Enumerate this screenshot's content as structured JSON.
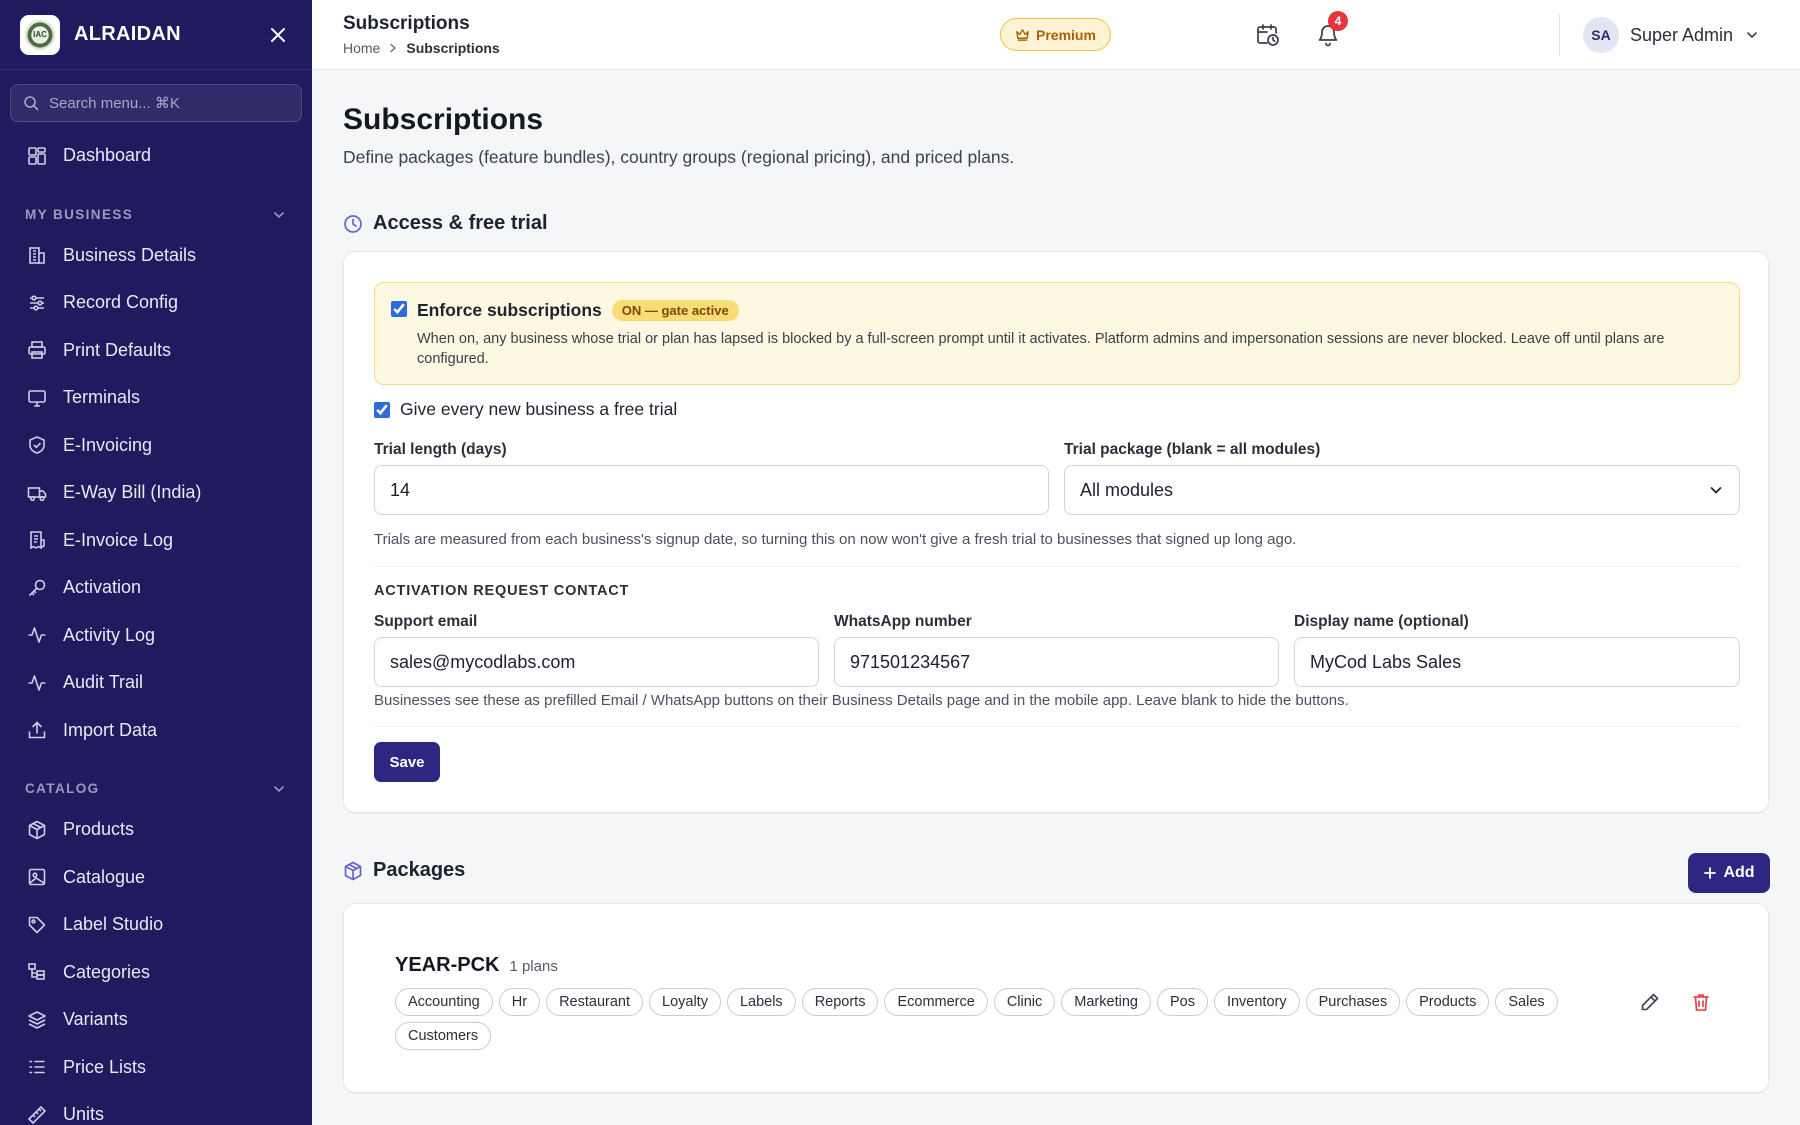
{
  "app": {
    "name": "ALRAIDAN",
    "logo_text": "IAC"
  },
  "sidebar": {
    "search_placeholder": "Search menu... ⌘K",
    "items_top": [
      {
        "label": "Dashboard",
        "icon": "dashboard-icon"
      }
    ],
    "sections": [
      {
        "label": "MY BUSINESS",
        "items": [
          {
            "label": "Business Details",
            "icon": "building-icon"
          },
          {
            "label": "Record Config",
            "icon": "sliders-icon"
          },
          {
            "label": "Print Defaults",
            "icon": "printer-icon"
          },
          {
            "label": "Terminals",
            "icon": "monitor-icon"
          },
          {
            "label": "E-Invoicing",
            "icon": "shield-check-icon"
          },
          {
            "label": "E-Way Bill (India)",
            "icon": "truck-icon"
          },
          {
            "label": "E-Invoice Log",
            "icon": "receipt-icon"
          },
          {
            "label": "Activation",
            "icon": "key-icon"
          },
          {
            "label": "Activity Log",
            "icon": "activity-icon"
          },
          {
            "label": "Audit Trail",
            "icon": "activity-icon"
          },
          {
            "label": "Import Data",
            "icon": "upload-icon"
          }
        ]
      },
      {
        "label": "CATALOG",
        "items": [
          {
            "label": "Products",
            "icon": "package-icon"
          },
          {
            "label": "Catalogue",
            "icon": "image-icon"
          },
          {
            "label": "Label Studio",
            "icon": "tag-icon"
          },
          {
            "label": "Categories",
            "icon": "categories-icon"
          },
          {
            "label": "Variants",
            "icon": "layers-icon"
          },
          {
            "label": "Price Lists",
            "icon": "list-icon"
          },
          {
            "label": "Units",
            "icon": "ruler-icon"
          }
        ]
      }
    ]
  },
  "header": {
    "title": "Subscriptions",
    "breadcrumb": [
      "Home",
      "Subscriptions"
    ],
    "premium_label": "Premium",
    "notification_count": "4",
    "user": {
      "initials": "SA",
      "name": "Super Admin"
    }
  },
  "page": {
    "title": "Subscriptions",
    "description": "Define packages (feature bundles), country groups (regional pricing), and priced plans."
  },
  "access": {
    "section_title": "Access & free trial",
    "enforce": {
      "checked": true,
      "label": "Enforce subscriptions",
      "badge": "ON — gate active",
      "description": "When on, any business whose trial or plan has lapsed is blocked by a full-screen prompt until it activates. Platform admins and impersonation sessions are never blocked. Leave off until plans are configured."
    },
    "free_trial": {
      "checked": true,
      "label": "Give every new business a free trial"
    },
    "trial_length": {
      "label": "Trial length (days)",
      "value": "14"
    },
    "trial_package": {
      "label": "Trial package (blank = all modules)",
      "value": "All modules"
    },
    "trial_help": "Trials are measured from each business's signup date, so turning this on now won't give a fresh trial to businesses that signed up long ago.",
    "contact": {
      "heading": "ACTIVATION REQUEST CONTACT",
      "support_email": {
        "label": "Support email",
        "value": "sales@mycodlabs.com"
      },
      "whatsapp": {
        "label": "WhatsApp number",
        "value": "971501234567"
      },
      "display_name": {
        "label": "Display name (optional)",
        "value": "MyCod Labs Sales"
      },
      "help": "Businesses see these as prefilled Email / WhatsApp buttons on their Business Details page and in the mobile app. Leave blank to hide the buttons."
    },
    "save_label": "Save"
  },
  "packages": {
    "section_title": "Packages",
    "add_label": "Add",
    "items": [
      {
        "name": "YEAR-PCK",
        "plans": "1 plans",
        "modules": [
          "Accounting",
          "Hr",
          "Restaurant",
          "Loyalty",
          "Labels",
          "Reports",
          "Ecommerce",
          "Clinic",
          "Marketing",
          "Pos",
          "Inventory",
          "Purchases",
          "Products",
          "Sales",
          "Customers"
        ]
      }
    ]
  },
  "colors": {
    "sidebar_bg": "#1f1b5e",
    "primary": "#2d2782",
    "accent_icon": "#6d5fd6",
    "warning_bg": "#fdf8e2",
    "danger": "#e5373d"
  }
}
